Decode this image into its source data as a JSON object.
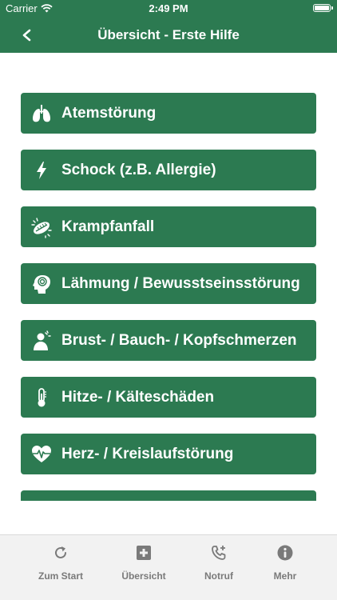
{
  "status_bar": {
    "carrier": "Carrier",
    "time": "2:49 PM"
  },
  "nav": {
    "title": "Übersicht - Erste Hilfe",
    "back_icon": "chevron-left-icon"
  },
  "menu": [
    {
      "label": "Atemstörung",
      "icon": "lungs-icon"
    },
    {
      "label": "Schock (z.B. Allergie)",
      "icon": "lightning-icon"
    },
    {
      "label": "Krampfanfall",
      "icon": "seizure-icon"
    },
    {
      "label": "Lähmung / Bewusstseinsstörung",
      "icon": "head-spiral-icon"
    },
    {
      "label": "Brust- / Bauch- / Kopfschmerzen",
      "icon": "person-pain-icon"
    },
    {
      "label": "Hitze- / Kälteschäden",
      "icon": "thermometer-icon"
    },
    {
      "label": "Herz- / Kreislaufstörung",
      "icon": "heart-pulse-icon"
    }
  ],
  "tabs": [
    {
      "label": "Zum Start",
      "icon": "refresh-icon"
    },
    {
      "label": "Übersicht",
      "icon": "medical-cross-icon"
    },
    {
      "label": "Notruf",
      "icon": "phone-plus-icon"
    },
    {
      "label": "Mehr",
      "icon": "info-icon"
    }
  ],
  "colors": {
    "primary": "#2c7a51",
    "tab_bar": "#f2f2f2",
    "tab_icon": "#7a7a7a"
  }
}
